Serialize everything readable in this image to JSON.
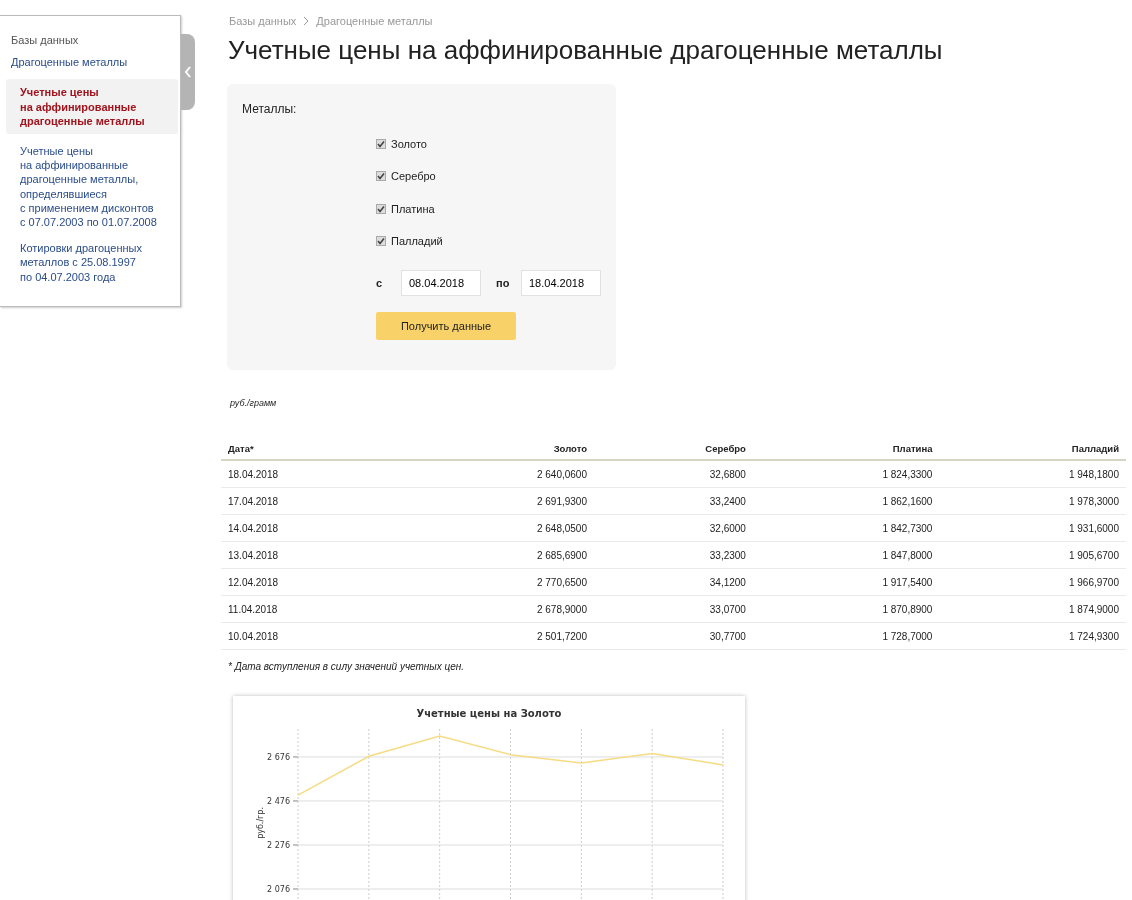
{
  "sidebar": {
    "items": [
      {
        "label": "Базы данных",
        "selected": false
      },
      {
        "label": "Драгоценные металлы",
        "selected": false
      },
      {
        "label": "Учетные цены\nна аффинированные\nдрагоценные металлы",
        "selected": true
      },
      {
        "label": "Учетные цены\nна аффинированные\nдрагоценные металлы,\nопределявшиеся\nс применением дисконтов\nс 07.07.2003 по 01.07.2008",
        "selected": false
      },
      {
        "label": "Котировки драгоценных\nметаллов с 25.08.1997\nпо 04.07.2003 года",
        "selected": false
      }
    ]
  },
  "breadcrumbs": [
    "Базы данных",
    "Драгоценные металлы"
  ],
  "title": "Учетные цены на аффинированные драгоценные металлы",
  "form": {
    "label": "Металлы:",
    "metals": [
      {
        "label": "Золото",
        "checked": true
      },
      {
        "label": "Серебро",
        "checked": true
      },
      {
        "label": "Платина",
        "checked": true
      },
      {
        "label": "Палладий",
        "checked": true
      }
    ],
    "from_label": "с",
    "from_value": "08.04.2018",
    "to_label": "по",
    "to_value": "18.04.2018",
    "submit": "Получить данные"
  },
  "units": "руб./грамм",
  "table": {
    "columns": [
      "Дата*",
      "Золото",
      "Серебро",
      "Платина",
      "Палладий"
    ],
    "rows": [
      [
        "18.04.2018",
        "2 640,0600",
        "32,6800",
        "1 824,3300",
        "1 948,1800"
      ],
      [
        "17.04.2018",
        "2 691,9300",
        "33,2400",
        "1 862,1600",
        "1 978,3000"
      ],
      [
        "14.04.2018",
        "2 648,0500",
        "32,6000",
        "1 842,7300",
        "1 931,6000"
      ],
      [
        "13.04.2018",
        "2 685,6900",
        "33,2300",
        "1 847,8000",
        "1 905,6700"
      ],
      [
        "12.04.2018",
        "2 770,6500",
        "34,1200",
        "1 917,5400",
        "1 966,9700"
      ],
      [
        "11.04.2018",
        "2 678,9000",
        "33,0700",
        "1 870,8900",
        "1 874,9000"
      ],
      [
        "10.04.2018",
        "2 501,7200",
        "30,7700",
        "1 728,7000",
        "1 724,9300"
      ]
    ]
  },
  "footnote": "* Дата вступления в силу значений учетных цен.",
  "chart": {
    "chart_data": {
      "type": "line",
      "title": "Учетные цены на Золото",
      "ylabel": "руб./гр.",
      "ylim": [
        1876,
        2803
      ],
      "yticks": [
        {
          "value": 2076,
          "label": "2 076"
        },
        {
          "value": 2276,
          "label": "2 276"
        },
        {
          "value": 2476,
          "label": "2 476"
        },
        {
          "value": 2676,
          "label": "2 676"
        }
      ],
      "grid": true,
      "series": [
        {
          "color": "#f5dc82",
          "values": [
            2502,
            2679,
            2771,
            2686,
            2648,
            2692,
            2640
          ]
        }
      ]
    }
  }
}
